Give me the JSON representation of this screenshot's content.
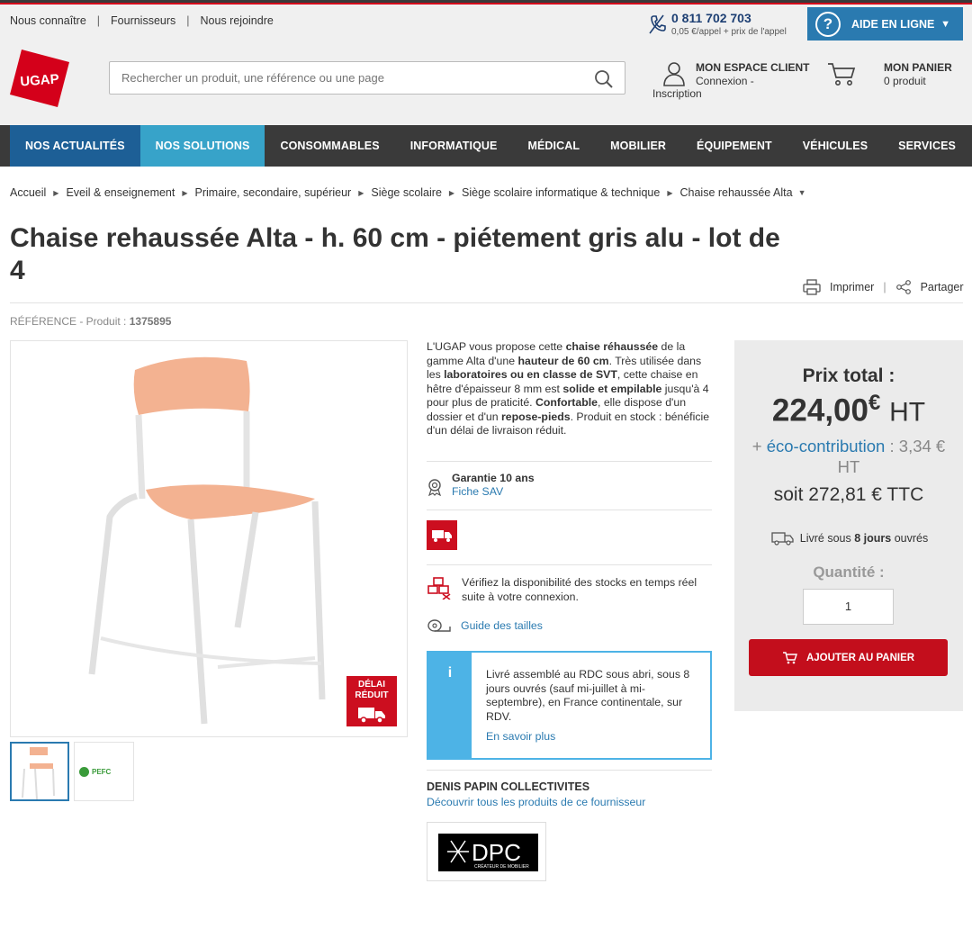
{
  "top_links": [
    "Nous connaître",
    "Fournisseurs",
    "Nous rejoindre"
  ],
  "phone": {
    "number": "0 811 702 703",
    "note": "0,05 €/appel + prix de l'appel"
  },
  "help": {
    "label": "AIDE EN LIGNE"
  },
  "logo": {
    "text": "UGAP",
    "color": "#d4001a"
  },
  "search": {
    "placeholder": "Rechercher un produit, une référence ou une page"
  },
  "account": {
    "title": "MON ESPACE CLIENT",
    "line1": "Connexion -",
    "line2": "Inscription"
  },
  "cart": {
    "title": "MON PANIER",
    "count": "0 produit"
  },
  "nav": [
    "NOS ACTUALITÉS",
    "NOS SOLUTIONS",
    "CONSOMMABLES",
    "INFORMATIQUE",
    "MÉDICAL",
    "MOBILIER",
    "ÉQUIPEMENT",
    "VÉHICULES",
    "SERVICES"
  ],
  "breadcrumb": [
    "Accueil",
    "Eveil & enseignement",
    "Primaire, secondaire, supérieur",
    "Siège scolaire",
    "Siège scolaire informatique & technique",
    "Chaise rehaussée Alta"
  ],
  "product": {
    "title": "Chaise rehaussée Alta - h. 60 cm - piétement gris alu - lot de 4",
    "ref_label": "RÉFÉRENCE - Produit :",
    "ref_value": "1375895",
    "badge_line1": "DÉLAI",
    "badge_line2": "RÉDUIT"
  },
  "actions": {
    "print": "Imprimer",
    "share": "Partager"
  },
  "description": {
    "p1": "L'UGAP vous propose cette ",
    "b1": "chaise réhaussée",
    "p2": " de la gamme Alta d'une ",
    "b2": "hauteur de 60 cm",
    "p3": ". Très utilisée dans les ",
    "b3": "laboratoires ou en classe de SVT",
    "p4": ", cette chaise en hêtre d'épaisseur 8 mm est ",
    "b4": "solide et empilable",
    "p5": " jusqu'à 4 pour plus de praticité. ",
    "b5": "Confortable",
    "p6": ", elle dispose d'un dossier et d'un ",
    "b6": "repose-pieds",
    "p7": ". Produit en stock : bénéficie d'un délai de livraison réduit."
  },
  "warranty": {
    "title": "Garantie 10 ans",
    "link": "Fiche SAV"
  },
  "stock_note": "Vérifiez la disponibilité des stocks en temps réel suite à votre connexion.",
  "size_guide": "Guide des tailles",
  "info": {
    "icon": "i",
    "text": "Livré assemblé au RDC sous abri, sous 8 jours ouvrés (sauf mi-juillet à mi-septembre), en France continentale, sur RDV.",
    "link": "En savoir plus"
  },
  "supplier": {
    "name": "DENIS PAPIN COLLECTIVITES",
    "link": "Découvrir tous les produits de ce fournisseur",
    "logo_text": "DPC",
    "logo_sub": "CRÉATEUR DE MOBILIER"
  },
  "thumb_pefc": "PEFC",
  "price": {
    "label": "Prix total :",
    "amount": "224,00",
    "currency": "€",
    "ht": "HT",
    "eco_plus": "+ ",
    "eco_label": "éco-contribution",
    "eco_value": " : 3,34 € HT",
    "ttc": "soit 272,81 € TTC",
    "delivery_pre": "Livré sous ",
    "delivery_bold": "8 jours",
    "delivery_post": " ouvrés",
    "qty_label": "Quantité :",
    "qty_value": "1",
    "add_button": "AJOUTER AU PANIER"
  }
}
